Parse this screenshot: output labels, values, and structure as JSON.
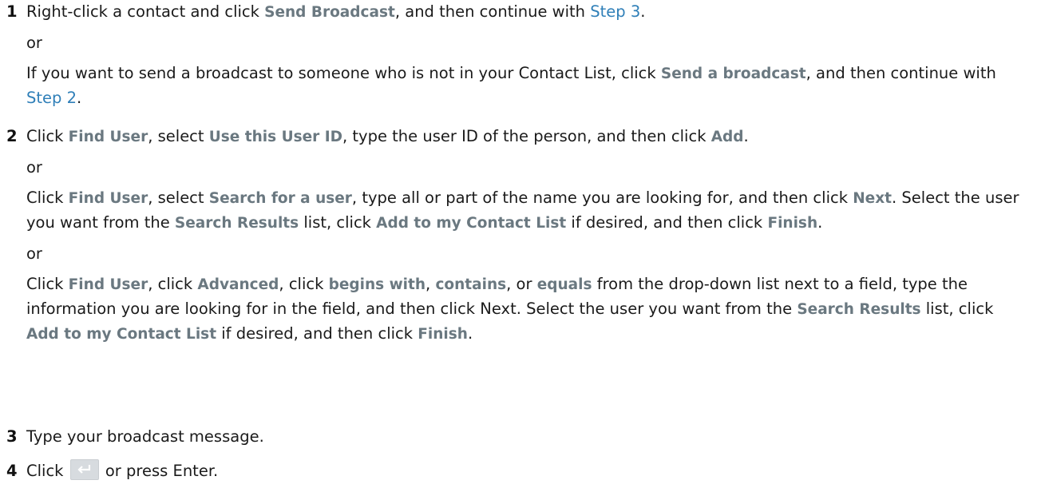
{
  "steps": [
    {
      "number": "1",
      "p1": {
        "t1": "Right-click a contact and click ",
        "ui1": "Send Broadcast",
        "t2": ", and then continue with ",
        "link1": "Step 3",
        "t3": "."
      },
      "or1": "or",
      "p2": {
        "t1": "If you want to send a broadcast to someone who is not in your Contact List, click ",
        "ui1": "Send a broadcast",
        "t2": ", and then continue with ",
        "link1": "Step 2",
        "t3": "."
      }
    },
    {
      "number": "2",
      "p1": {
        "t1": "Click ",
        "ui1": "Find User",
        "t2": ", select ",
        "ui2": "Use this User ID",
        "t3": ", type the user ID of the person, and then click ",
        "ui3": "Add",
        "t4": "."
      },
      "or1": "or",
      "p2": {
        "t1": "Click ",
        "ui1": "Find User",
        "t2": ", select ",
        "ui2": "Search for a user",
        "t3": ", type all or part of the name you are looking for, and then click ",
        "ui3": "Next",
        "t4": ". Select the user you want from the ",
        "ui4": "Search Results",
        "t5": " list, click ",
        "ui5": "Add to my Contact List",
        "t6": " if desired, and then click ",
        "ui6": "Finish",
        "t7": "."
      },
      "or2": "or",
      "p3": {
        "t1": "Click ",
        "ui1": "Find User",
        "t2": ", click ",
        "ui2": "Advanced",
        "t3": ", click ",
        "ui3": "begins with",
        "t4": ", ",
        "ui4": "contains",
        "t5": ", or ",
        "ui5": "equals",
        "t6": " from the drop-down list next to a field, type the information you are looking for in the field, and then click Next. Select the user you want from the ",
        "ui6": "Search Results",
        "t7": " list, click ",
        "ui7": "Add to my Contact List",
        "t8": " if desired, and then click ",
        "ui8": "Finish",
        "t9": "."
      }
    },
    {
      "number": "3",
      "p1": {
        "t1": "Type your broadcast message."
      }
    },
    {
      "number": "4",
      "p1": {
        "t1": "Click ",
        "icon": "send-arrow-icon",
        "t2": " or press Enter."
      }
    }
  ]
}
